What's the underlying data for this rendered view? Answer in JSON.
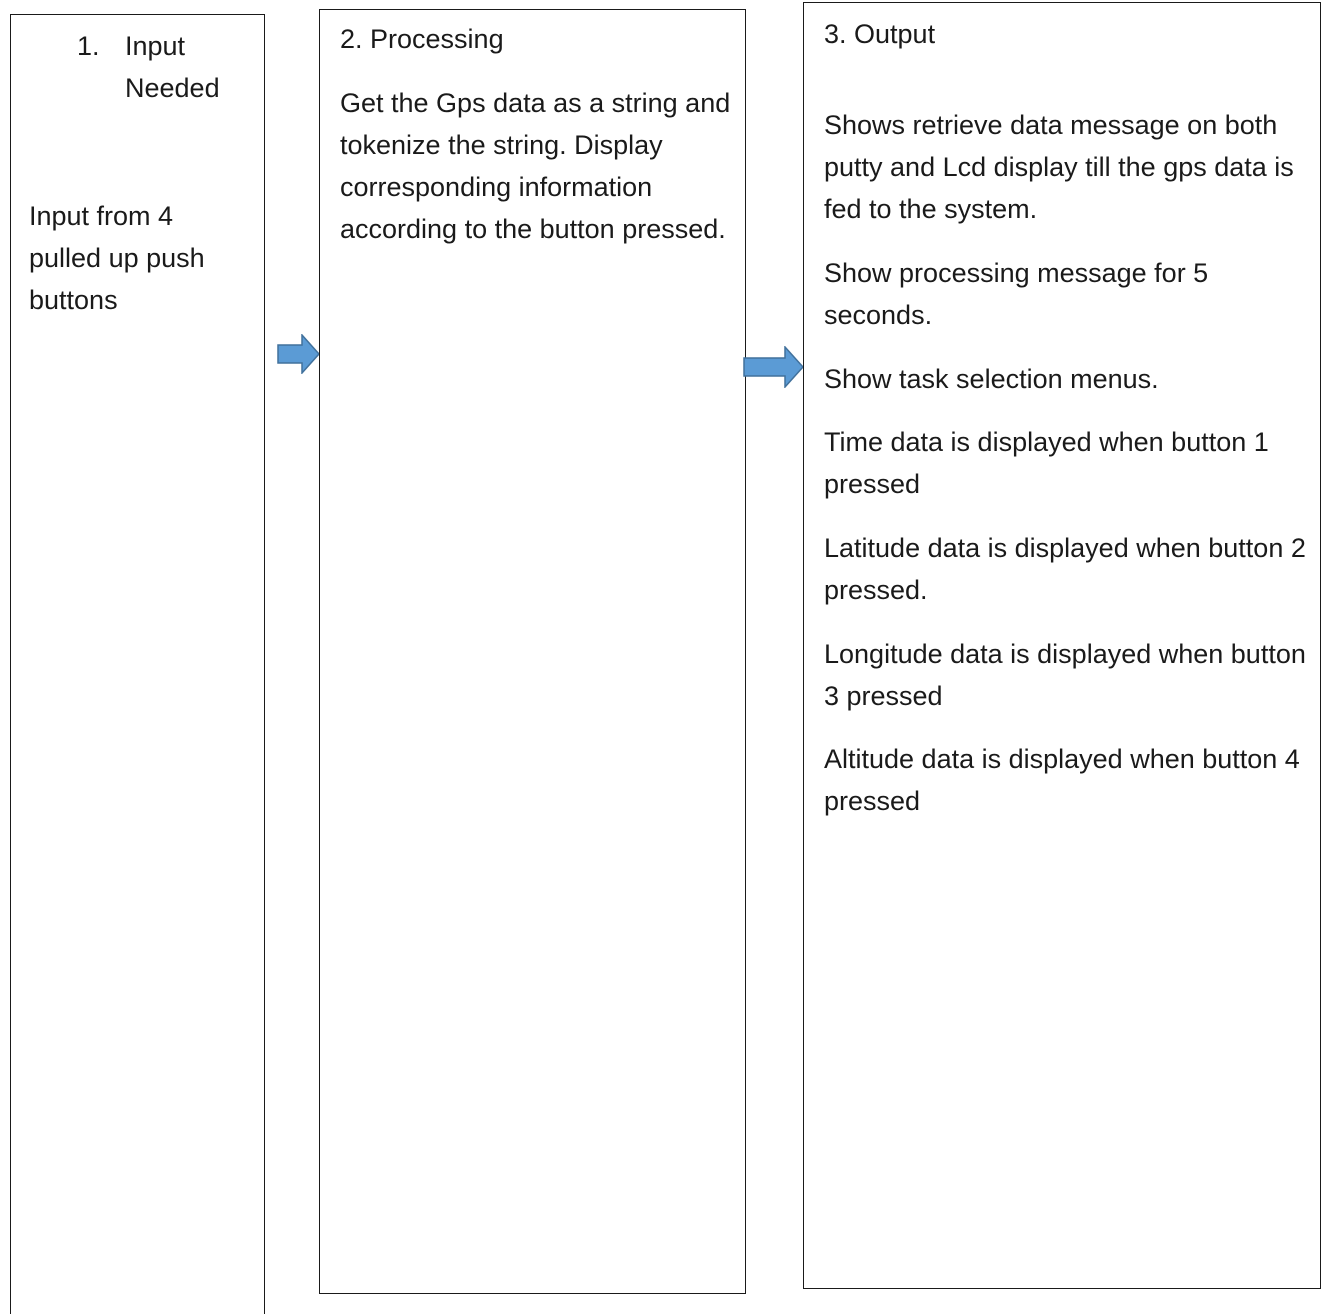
{
  "steps": {
    "input": {
      "number": "1.",
      "title": "Input Needed",
      "body": "Input from 4 pulled up push buttons"
    },
    "processing": {
      "title": "2. Processing",
      "body": "Get the Gps data as a string and tokenize the string. Display corresponding information according to the button pressed."
    },
    "output": {
      "title": "3. Output",
      "paragraphs": [
        "Shows retrieve data message on both putty and Lcd display till the gps data is fed to the system.",
        "Show processing message for 5 seconds.",
        "Show task selection menus.",
        "Time data is displayed when button 1 pressed",
        "Latitude data is displayed when button 2  pressed.",
        "Longitude data is displayed when button 3  pressed",
        "Altitude data is displayed when button 4 pressed"
      ]
    }
  },
  "colors": {
    "arrow_fill": "#5b9bd5",
    "arrow_stroke": "#41719c",
    "border": "#1a1a1a"
  },
  "icons": [
    "right-arrow-icon",
    "right-arrow-icon"
  ]
}
